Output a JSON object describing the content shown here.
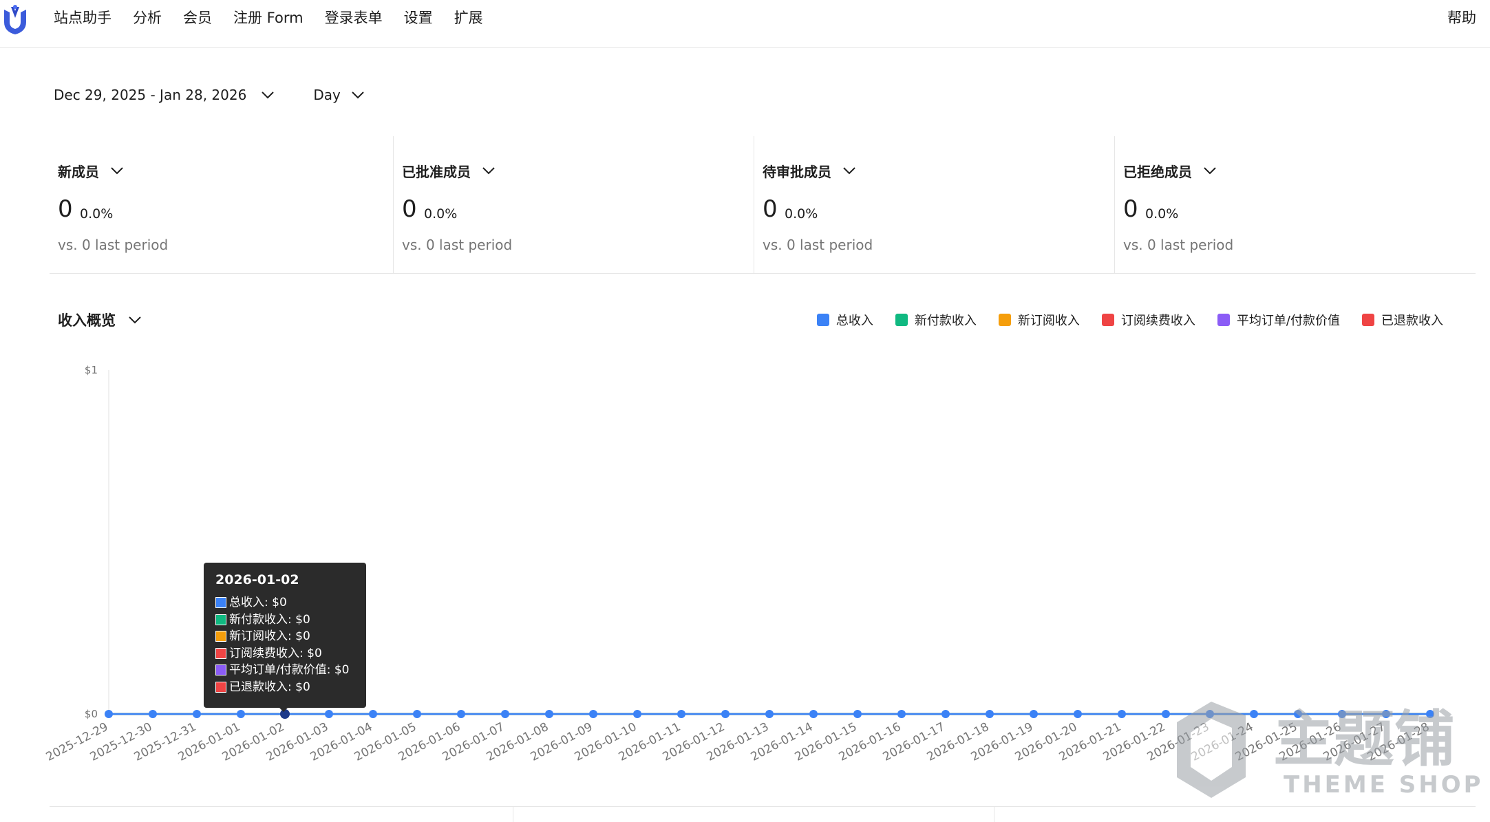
{
  "app": {
    "logo_icon": "brand-logo-icon",
    "nav": [
      "站点助手",
      "分析",
      "会员",
      "注册 Form",
      "登录表单",
      "设置",
      "扩展"
    ],
    "help": "帮助"
  },
  "filters": {
    "date_range": "Dec 29, 2025 - Jan 28, 2026",
    "interval": "Day"
  },
  "stats": [
    {
      "title": "新成员",
      "value": "0",
      "delta": "0.0%",
      "compare": "vs. 0 last period"
    },
    {
      "title": "已批准成员",
      "value": "0",
      "delta": "0.0%",
      "compare": "vs. 0 last period"
    },
    {
      "title": "待审批成员",
      "value": "0",
      "delta": "0.0%",
      "compare": "vs. 0 last period"
    },
    {
      "title": "已拒绝成员",
      "value": "0",
      "delta": "0.0%",
      "compare": "vs. 0 last period"
    }
  ],
  "revenue": {
    "title": "收入概览",
    "legend": [
      {
        "label": "总收入",
        "color": "#3b82f6"
      },
      {
        "label": "新付款收入",
        "color": "#10b981"
      },
      {
        "label": "新订阅收入",
        "color": "#f59e0b"
      },
      {
        "label": "订阅续费收入",
        "color": "#ef4444"
      },
      {
        "label": "平均订单/付款价值",
        "color": "#8b5cf6"
      },
      {
        "label": "已退款收入",
        "color": "#ef4444"
      }
    ]
  },
  "chart_data": {
    "type": "line",
    "x": [
      "2025-12-29",
      "2025-12-30",
      "2025-12-31",
      "2026-01-01",
      "2026-01-02",
      "2026-01-03",
      "2026-01-04",
      "2026-01-05",
      "2026-01-06",
      "2026-01-07",
      "2026-01-08",
      "2026-01-09",
      "2026-01-10",
      "2026-01-11",
      "2026-01-12",
      "2026-01-13",
      "2026-01-14",
      "2026-01-15",
      "2026-01-16",
      "2026-01-17",
      "2026-01-18",
      "2026-01-19",
      "2026-01-20",
      "2026-01-21",
      "2026-01-22",
      "2026-01-23",
      "2026-01-24",
      "2026-01-25",
      "2026-01-26",
      "2026-01-27",
      "2026-01-28"
    ],
    "series": [
      {
        "name": "总收入",
        "values": [
          0,
          0,
          0,
          0,
          0,
          0,
          0,
          0,
          0,
          0,
          0,
          0,
          0,
          0,
          0,
          0,
          0,
          0,
          0,
          0,
          0,
          0,
          0,
          0,
          0,
          0,
          0,
          0,
          0,
          0,
          0
        ]
      },
      {
        "name": "新付款收入",
        "values": [
          0,
          0,
          0,
          0,
          0,
          0,
          0,
          0,
          0,
          0,
          0,
          0,
          0,
          0,
          0,
          0,
          0,
          0,
          0,
          0,
          0,
          0,
          0,
          0,
          0,
          0,
          0,
          0,
          0,
          0,
          0
        ]
      },
      {
        "name": "新订阅收入",
        "values": [
          0,
          0,
          0,
          0,
          0,
          0,
          0,
          0,
          0,
          0,
          0,
          0,
          0,
          0,
          0,
          0,
          0,
          0,
          0,
          0,
          0,
          0,
          0,
          0,
          0,
          0,
          0,
          0,
          0,
          0,
          0
        ]
      },
      {
        "name": "订阅续费收入",
        "values": [
          0,
          0,
          0,
          0,
          0,
          0,
          0,
          0,
          0,
          0,
          0,
          0,
          0,
          0,
          0,
          0,
          0,
          0,
          0,
          0,
          0,
          0,
          0,
          0,
          0,
          0,
          0,
          0,
          0,
          0,
          0
        ]
      },
      {
        "name": "平均订单/付款价值",
        "values": [
          0,
          0,
          0,
          0,
          0,
          0,
          0,
          0,
          0,
          0,
          0,
          0,
          0,
          0,
          0,
          0,
          0,
          0,
          0,
          0,
          0,
          0,
          0,
          0,
          0,
          0,
          0,
          0,
          0,
          0,
          0
        ]
      },
      {
        "name": "已退款收入",
        "values": [
          0,
          0,
          0,
          0,
          0,
          0,
          0,
          0,
          0,
          0,
          0,
          0,
          0,
          0,
          0,
          0,
          0,
          0,
          0,
          0,
          0,
          0,
          0,
          0,
          0,
          0,
          0,
          0,
          0,
          0,
          0
        ]
      }
    ],
    "yticks": [
      "$1",
      "$0"
    ],
    "ylim": [
      0,
      1
    ],
    "legend_position": "top-right",
    "grid": false
  },
  "tooltip": {
    "title": "2026-01-02",
    "rows": [
      {
        "text": "总收入: $0",
        "color": "#3b82f6"
      },
      {
        "text": "新付款收入: $0",
        "color": "#10b981"
      },
      {
        "text": "新订阅收入: $0",
        "color": "#f59e0b"
      },
      {
        "text": "订阅续费收入: $0",
        "color": "#ef4444"
      },
      {
        "text": "平均订单/付款价值: $0",
        "color": "#8b5cf6"
      },
      {
        "text": "已退款收入: $0",
        "color": "#ef4444"
      }
    ]
  },
  "watermark": {
    "text1": "主题铺",
    "text2": "THEME SHOP"
  }
}
